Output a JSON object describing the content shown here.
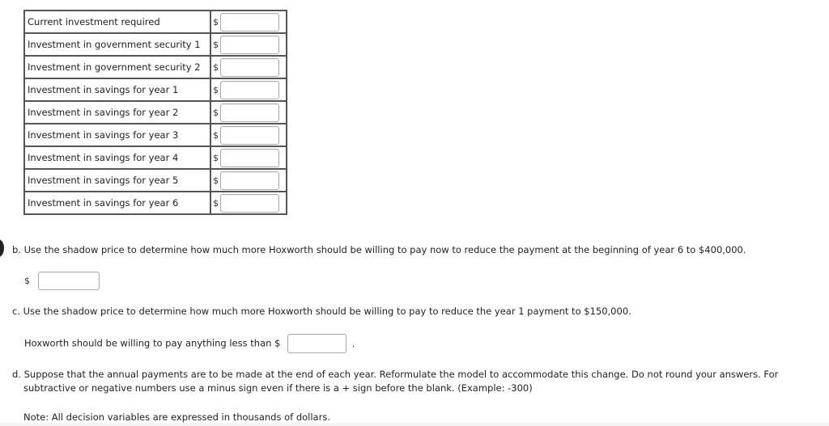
{
  "table": {
    "currency_symbol": "$",
    "rows": [
      {
        "label": "Current investment required",
        "value": ""
      },
      {
        "label": "Investment in government security 1",
        "value": ""
      },
      {
        "label": "Investment in government security 2",
        "value": ""
      },
      {
        "label": "Investment in savings for year 1",
        "value": ""
      },
      {
        "label": "Investment in savings for year 2",
        "value": ""
      },
      {
        "label": "Investment in savings for year 3",
        "value": ""
      },
      {
        "label": "Investment in savings for year 4",
        "value": ""
      },
      {
        "label": "Investment in savings for year 5",
        "value": ""
      },
      {
        "label": "Investment in savings for year 6",
        "value": ""
      }
    ]
  },
  "part_b": {
    "question": "b. Use the shadow price to determine how much more Hoxworth should be willing to pay now to reduce the payment at the beginning of year 6 to $400,000.",
    "currency_symbol": "$",
    "answer": ""
  },
  "part_c": {
    "question": "c. Use the shadow price to determine how much more Hoxworth should be willing to pay to reduce the year 1 payment to $150,000.",
    "answer_prefix": "Hoxworth should be willing to pay anything less than $",
    "answer": "",
    "answer_suffix": "."
  },
  "part_d": {
    "question_line1": "d. Suppose that the annual payments are to be made at the end of each year. Reformulate the model to accommodate this change. Do not round your answers. For",
    "question_line2": "subtractive or negative numbers use a minus sign even if there is a + sign before the blank. (Example: -300)",
    "note": "Note: All decision variables are expressed in thousands of dollars."
  }
}
